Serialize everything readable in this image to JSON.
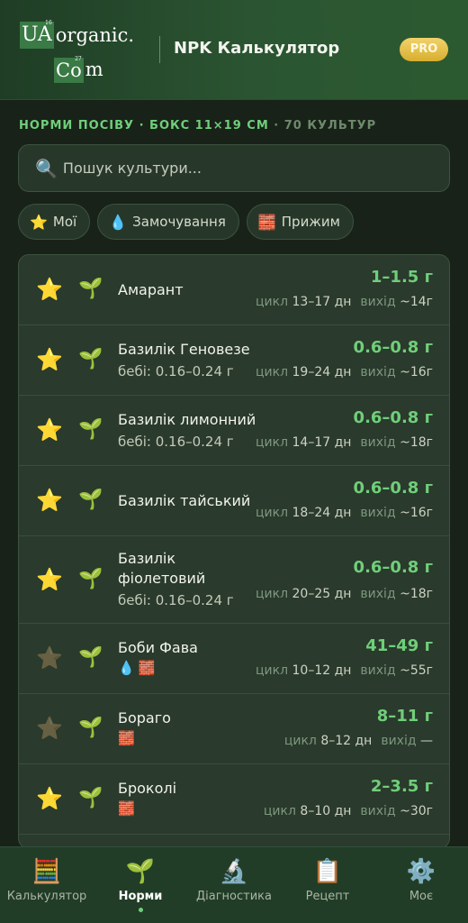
{
  "header": {
    "logo_tile1": "UA",
    "logo_text1": "organic.",
    "logo_tile2": "Co",
    "logo_text2": "m",
    "title": "NPK Калькулятор",
    "pro_badge": "PRO"
  },
  "subtitle": {
    "main": "НОРМИ ПОСІВУ · БОКС 11×19 СМ",
    "count": "· 70 КУЛЬТУР"
  },
  "search": {
    "placeholder": "Пошук культури..."
  },
  "chips": [
    {
      "icon": "star-icon",
      "label": "Мої"
    },
    {
      "icon": "droplet-icon",
      "label": "Замочування"
    },
    {
      "icon": "bricks-icon",
      "label": "Прижим"
    }
  ],
  "crops": [
    {
      "favorite": true,
      "name": "Амарант",
      "baby": "",
      "tags": [],
      "rate": "1–1.5 г",
      "cycle_label": "цикл",
      "cycle": "13–17 дн",
      "yield_label": "вихід",
      "yield": "~14г"
    },
    {
      "favorite": true,
      "name": "Базилік Геновезе",
      "baby": "бебі: 0.16–0.24 г",
      "tags": [],
      "rate": "0.6–0.8 г",
      "cycle_label": "цикл",
      "cycle": "19–24 дн",
      "yield_label": "вихід",
      "yield": "~16г"
    },
    {
      "favorite": true,
      "name": "Базилік лимонний",
      "baby": "бебі: 0.16–0.24 г",
      "tags": [],
      "rate": "0.6–0.8 г",
      "cycle_label": "цикл",
      "cycle": "14–17 дн",
      "yield_label": "вихід",
      "yield": "~18г"
    },
    {
      "favorite": true,
      "name": "Базилік тайський",
      "baby": "",
      "tags": [],
      "rate": "0.6–0.8 г",
      "cycle_label": "цикл",
      "cycle": "18–24 дн",
      "yield_label": "вихід",
      "yield": "~16г"
    },
    {
      "favorite": true,
      "name": "Базилік фіолетовий",
      "baby": "бебі: 0.16–0.24 г",
      "tags": [],
      "rate": "0.6–0.8 г",
      "cycle_label": "цикл",
      "cycle": "20–25 дн",
      "yield_label": "вихід",
      "yield": "~18г"
    },
    {
      "favorite": false,
      "name": "Боби Фава",
      "baby": "",
      "tags": [
        "droplet-icon",
        "bricks-icon"
      ],
      "rate": "41–49 г",
      "cycle_label": "цикл",
      "cycle": "10–12 дн",
      "yield_label": "вихід",
      "yield": "~55г"
    },
    {
      "favorite": false,
      "name": "Бораго",
      "baby": "",
      "tags": [
        "bricks-icon"
      ],
      "rate": "8–11 г",
      "cycle_label": "цикл",
      "cycle": "8–12 дн",
      "yield_label": "вихід",
      "yield": "—"
    },
    {
      "favorite": true,
      "name": "Броколі",
      "baby": "",
      "tags": [
        "bricks-icon"
      ],
      "rate": "2–3.5 г",
      "cycle_label": "цикл",
      "cycle": "8–10 дн",
      "yield_label": "вихід",
      "yield": "~30г"
    }
  ],
  "tabs": [
    {
      "icon": "abacus-icon",
      "label": "Калькулятор",
      "active": false
    },
    {
      "icon": "seedling-icon",
      "label": "Норми",
      "active": true
    },
    {
      "icon": "microscope-icon",
      "label": "Діагностика",
      "active": false
    },
    {
      "icon": "clipboard-icon",
      "label": "Рецепт",
      "active": false
    },
    {
      "icon": "gear-icon",
      "label": "Моє",
      "active": false
    }
  ],
  "colors": {
    "accent": "#6fcf7a",
    "gold": "#e6c24d",
    "background": "#182218"
  }
}
